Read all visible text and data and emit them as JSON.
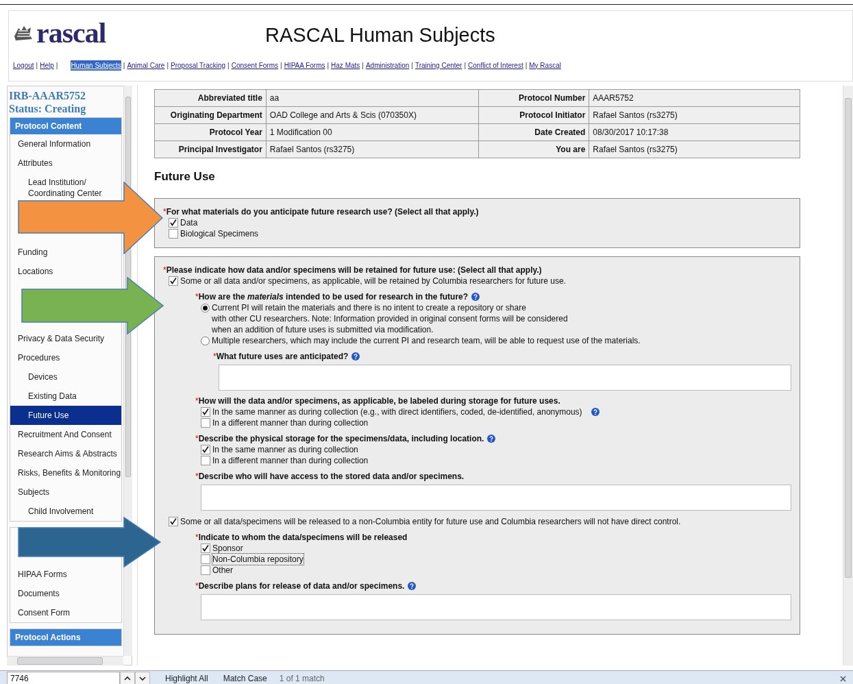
{
  "header": {
    "logo": "rascal",
    "title": "RASCAL Human Subjects",
    "separator": "|",
    "account_links": [
      "Logout",
      "Help"
    ],
    "module_links": [
      {
        "label": "Human Subjects",
        "selected": true
      },
      {
        "label": "Animal Care",
        "selected": false
      },
      {
        "label": "Proposal Tracking",
        "selected": false
      },
      {
        "label": "Consent Forms",
        "selected": false
      },
      {
        "label": "HIPAA Forms",
        "selected": false
      },
      {
        "label": "Haz Mats",
        "selected": false
      },
      {
        "label": "Administration",
        "selected": false
      },
      {
        "label": "Training Center",
        "selected": false
      },
      {
        "label": "Conflict of Interest",
        "selected": false
      },
      {
        "label": "My Rascal",
        "selected": false
      }
    ]
  },
  "sidebar": {
    "protocol_id": "IRB-AAAR5752",
    "status": "Status: Creating",
    "sections": [
      {
        "header": "Protocol Content",
        "items": [
          {
            "kind": "link",
            "label": "General Information",
            "selected": false
          },
          {
            "kind": "link",
            "label": "Attributes",
            "selected": false,
            "children": [
              {
                "kind": "link",
                "label": "Lead Institution/ Coordinating Center",
                "selected": false
              }
            ]
          },
          {
            "kind": "arrow",
            "color": "#f39240"
          },
          {
            "kind": "link",
            "label": "Funding",
            "selected": false
          },
          {
            "kind": "link",
            "label": "Locations",
            "selected": false
          },
          {
            "kind": "arrow",
            "color": "#79b250"
          },
          {
            "kind": "link",
            "label": "Privacy & Data Security",
            "selected": false
          },
          {
            "kind": "link",
            "label": "Procedures",
            "selected": false,
            "children": [
              {
                "kind": "link",
                "label": "Devices",
                "selected": false
              },
              {
                "kind": "link",
                "label": "Existing Data",
                "selected": false
              },
              {
                "kind": "link",
                "label": "Future Use",
                "selected": true
              }
            ]
          },
          {
            "kind": "link",
            "label": "Recruitment And Consent",
            "selected": false
          },
          {
            "kind": "link",
            "label": "Research Aims & Abstracts",
            "selected": false
          },
          {
            "kind": "link",
            "label": "Risks, Benefits & Monitoring",
            "selected": false
          },
          {
            "kind": "link",
            "label": "Subjects",
            "selected": false,
            "children": [
              {
                "kind": "link",
                "label": "Child Involvement",
                "selected": false
              }
            ]
          }
        ]
      },
      {
        "items": [
          {
            "kind": "arrow",
            "color": "#2d6591"
          },
          {
            "kind": "link",
            "label": "HIPAA Forms",
            "selected": false
          },
          {
            "kind": "link",
            "label": "Documents",
            "selected": false
          },
          {
            "kind": "link",
            "label": "Consent Form",
            "selected": false
          }
        ]
      },
      {
        "header": "Protocol Actions"
      }
    ]
  },
  "summary": [
    [
      {
        "label": "Abbreviated title",
        "value": "aa"
      },
      {
        "label": "Protocol Number",
        "value": "AAAR5752"
      }
    ],
    [
      {
        "label": "Originating Department",
        "value": "OAD College and Arts & Scis (070350X)"
      },
      {
        "label": "Protocol Initiator",
        "value": "Rafael Santos (rs3275)"
      }
    ],
    [
      {
        "label": "Protocol Year",
        "value": "1 Modification 00"
      },
      {
        "label": "Date Created",
        "value": "08/30/2017 10:17:38"
      }
    ],
    [
      {
        "label": "Principal Investigator",
        "value": "Rafael Santos (rs3275)"
      },
      {
        "label": "You are",
        "value": "Rafael Santos (rs3275)"
      }
    ]
  ],
  "page_title": "Future Use",
  "required_mark": "*",
  "form_boxes": [
    {
      "items": [
        {
          "kind": "question",
          "text": "For what materials do you anticipate future research use? (Select all that apply.)",
          "required": true,
          "help": false,
          "children": [
            {
              "kind": "checkbox",
              "label": "Data",
              "checked": true
            },
            {
              "kind": "checkbox",
              "label": "Biological Specimens",
              "checked": false
            }
          ]
        }
      ]
    },
    {
      "items": [
        {
          "kind": "question",
          "text": "Please indicate how data and/or specimens will be retained for future use: (Select all that apply.)",
          "required": true,
          "help": false,
          "children": [
            {
              "kind": "checkbox",
              "label": "Some or all data and/or specimens, as applicable, will be retained by Columbia researchers for future use.",
              "checked": true,
              "children": [
                {
                  "kind": "question",
                  "text": "How are the *materials* intended to be used for research in the future?",
                  "required": true,
                  "help": true,
                  "children": [
                    {
                      "kind": "radio",
                      "label": "Current PI will retain the materials and there is no intent to create a repository or share\nwith other CU researchers. Note: Information provided in original consent forms will be considered\nwhen an addition of future uses is submitted via modification.",
                      "selected": true
                    },
                    {
                      "kind": "radio",
                      "label": "Multiple researchers, which may include the current PI and research team, will be able to request use of the materials.",
                      "selected": false
                    },
                    {
                      "kind": "question",
                      "text": "What future uses are anticipated?",
                      "required": true,
                      "help": true,
                      "children": [
                        {
                          "kind": "textarea"
                        }
                      ]
                    }
                  ]
                },
                {
                  "kind": "question",
                  "text": "How will the data and/or specimens, as applicable, be labeled during storage for future uses.",
                  "required": true,
                  "help": false,
                  "children": [
                    {
                      "kind": "checkbox",
                      "label": "In the same manner as during collection (e.g., with direct identifiers, coded, de-identified, anonymous)",
                      "checked": true,
                      "help": true
                    },
                    {
                      "kind": "checkbox",
                      "label": "In a different manner than during collection",
                      "checked": false
                    }
                  ]
                },
                {
                  "kind": "question",
                  "text": "Describe the physical storage for the specimens/data, including location.",
                  "required": true,
                  "help": true,
                  "children": [
                    {
                      "kind": "checkbox",
                      "label": "In the same manner as during collection",
                      "checked": true
                    },
                    {
                      "kind": "checkbox",
                      "label": "In a different manner than during collection",
                      "checked": false
                    }
                  ]
                },
                {
                  "kind": "question",
                  "text": "Describe who will have access to the stored data and/or specimens.",
                  "required": true,
                  "help": false,
                  "children": [
                    {
                      "kind": "textarea"
                    }
                  ]
                }
              ]
            },
            {
              "kind": "checkbox",
              "label": "Some or all data/specimens will be released to a non-Columbia entity for future use and Columbia researchers will not have direct control.",
              "checked": true,
              "children": [
                {
                  "kind": "question",
                  "text": "Indicate to whom the data/specimens will be released",
                  "required": true,
                  "help": false,
                  "children": [
                    {
                      "kind": "checkbox",
                      "label": "Sponsor",
                      "checked": true
                    },
                    {
                      "kind": "checkbox",
                      "label": "Non-Columbia repository",
                      "checked": false,
                      "focused": true
                    },
                    {
                      "kind": "checkbox",
                      "label": "Other",
                      "checked": false
                    }
                  ]
                },
                {
                  "kind": "question",
                  "text": "Describe plans for release of data and/or specimens.",
                  "required": true,
                  "help": true,
                  "children": [
                    {
                      "kind": "textarea"
                    }
                  ]
                }
              ]
            }
          ]
        }
      ]
    }
  ],
  "find_bar": {
    "query": "7746",
    "options": [
      "Highlight All",
      "Match Case"
    ],
    "result": "1 of 1 match"
  }
}
